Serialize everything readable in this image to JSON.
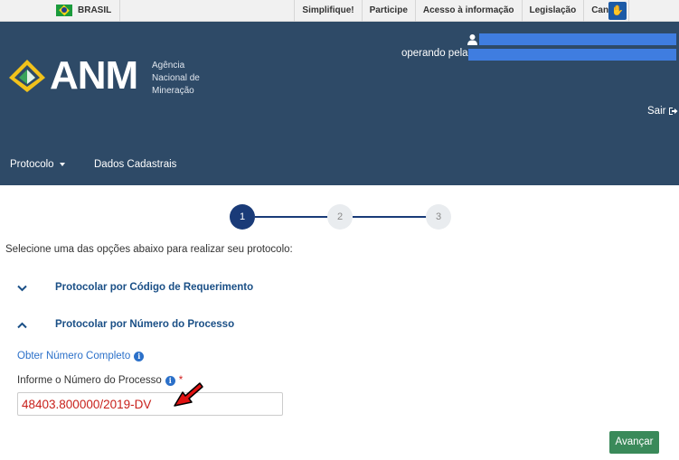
{
  "govbar": {
    "country": "BRASIL",
    "links": [
      "Simplifique!",
      "Participe",
      "Acesso à informação",
      "Legislação",
      "Canais"
    ],
    "accessibility_icon": "vlibras-hands-icon"
  },
  "header": {
    "logo_text": "ANM",
    "agency_name": "Agência Nacional de Mineração",
    "operating_label": "operando pela:",
    "logout": "Sair",
    "colors": {
      "background": "#2e4a67",
      "redacted": "#3f7de0"
    }
  },
  "nav": {
    "items": [
      {
        "label": "Protocolo",
        "has_dropdown": true
      },
      {
        "label": "Dados Cadastrais",
        "has_dropdown": false
      }
    ]
  },
  "stepper": {
    "steps": [
      "1",
      "2",
      "3"
    ],
    "current": 1
  },
  "main": {
    "instruction": "Selecione uma das opções abaixo para realizar seu protocolo:",
    "accordions": [
      {
        "title": "Protocolar por Código de Requerimento",
        "expanded": false
      },
      {
        "title": "Protocolar por Número do Processo",
        "expanded": true
      }
    ],
    "get_full_number_link": "Obter Número Completo",
    "process_field": {
      "label": "Informe o Número do Processo",
      "required_mark": "*",
      "value": "48403.800000/2019-DV"
    },
    "next_button": "Avançar"
  }
}
